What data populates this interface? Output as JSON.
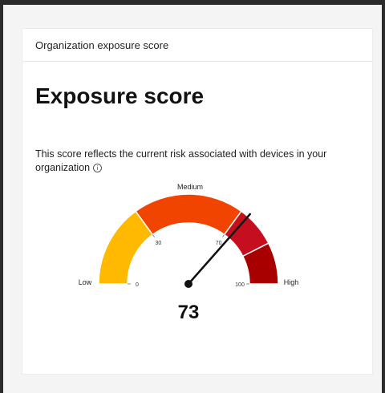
{
  "card": {
    "header": "Organization exposure score",
    "title": "Exposure score",
    "description": "This score reflects the current risk associated with devices in your organization",
    "info_icon": "info-icon",
    "info_symbol": "i"
  },
  "gauge": {
    "value": 73,
    "score_display": "73",
    "min": 0,
    "max": 100,
    "bands": [
      {
        "from": 0,
        "to": 30,
        "color": "#ffb900"
      },
      {
        "from": 30,
        "to": 70,
        "color": "#f04400"
      },
      {
        "from": 70,
        "to": 85,
        "color": "#c50f1f"
      },
      {
        "from": 85,
        "to": 100,
        "color": "#a80000"
      }
    ],
    "labels": {
      "low": "Low",
      "medium": "Medium",
      "high": "High",
      "tick_0": "0",
      "tick_30": "30",
      "tick_70": "70",
      "tick_100": "100"
    },
    "needle_color": "#111111"
  }
}
